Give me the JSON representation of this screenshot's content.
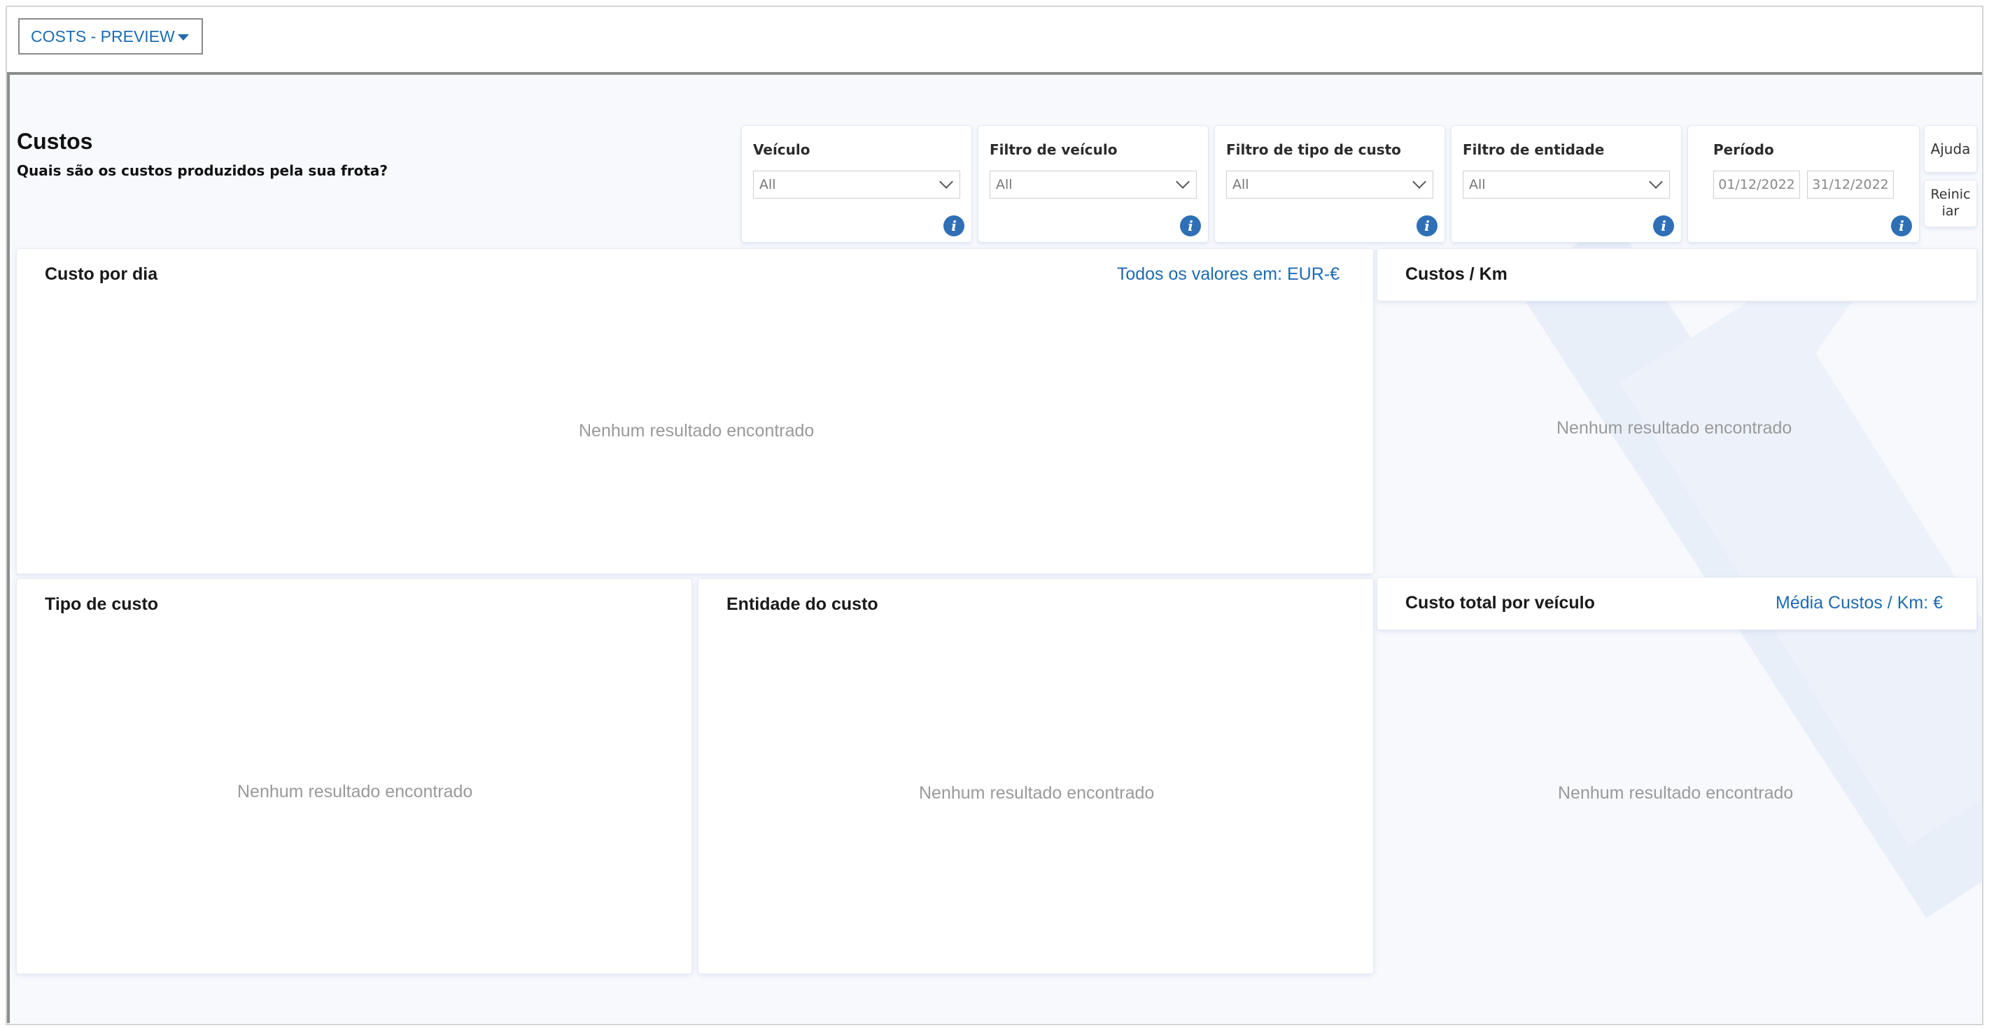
{
  "report": {
    "name": "COSTS - PREVIEW"
  },
  "page": {
    "title": "Custos",
    "subtitle": "Quais são os custos produzidos pela sua frota?"
  },
  "filters": {
    "vehicle": {
      "label": "Veículo",
      "value": "All"
    },
    "vehicle_filter": {
      "label": "Filtro de veículo",
      "value": "All"
    },
    "cost_type_filter": {
      "label": "Filtro de tipo de custo",
      "value": "All"
    },
    "entity_filter": {
      "label": "Filtro de entidade",
      "value": "All"
    },
    "period": {
      "label": "Período",
      "start": "01/12/2022",
      "end": "31/12/2022"
    }
  },
  "buttons": {
    "help": "Ajuda",
    "reset": "Reiniciar"
  },
  "visuals": {
    "cost_per_day": {
      "title": "Custo por dia",
      "note": "Todos os valores em: EUR-€",
      "empty": "Nenhum resultado encontrado"
    },
    "costs_per_km": {
      "title": "Custos / Km",
      "empty": "Nenhum resultado encontrado"
    },
    "cost_type": {
      "title": "Tipo de custo",
      "empty": "Nenhum resultado encontrado"
    },
    "cost_entity": {
      "title": "Entidade do custo",
      "empty": "Nenhum resultado encontrado"
    },
    "total_per_vehicle": {
      "title": "Custo total por veículo",
      "note": "Média Custos / Km: €",
      "empty": "Nenhum resultado encontrado"
    }
  },
  "icons": {
    "info": "info-icon",
    "dropdown": "chevron-down-icon"
  },
  "colors": {
    "accent": "#1e6bb0",
    "info": "#2f6fb5",
    "canvas": "#f7f9fd"
  }
}
